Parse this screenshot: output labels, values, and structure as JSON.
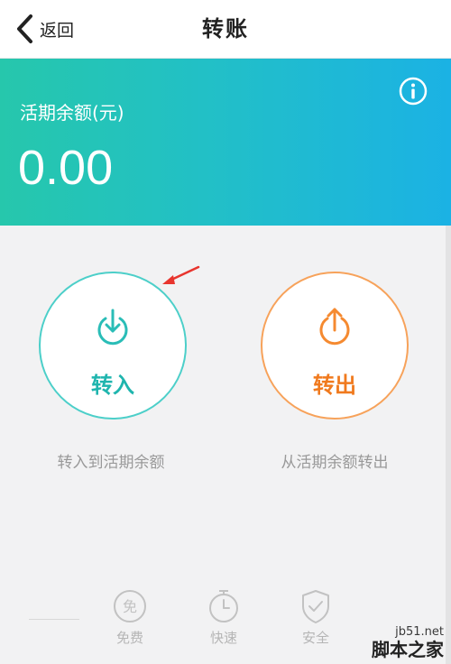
{
  "nav": {
    "back_label": "返回",
    "title": "转账"
  },
  "banner": {
    "balance_label": "活期余额(元)",
    "balance_value": "0.00",
    "gradient_colors": [
      "#26c7ac",
      "#1bb2e4"
    ]
  },
  "actions": [
    {
      "label": "转入",
      "description": "转入到活期余额",
      "color": "#1fb5ae",
      "icon": "download-circle-icon"
    },
    {
      "label": "转出",
      "description": "从活期余额转出",
      "color": "#f07a1e",
      "icon": "upload-circle-icon"
    }
  ],
  "features": [
    {
      "label": "免费",
      "icon": "free-icon"
    },
    {
      "label": "快速",
      "icon": "stopwatch-icon"
    },
    {
      "label": "安全",
      "icon": "shield-check-icon"
    }
  ],
  "watermark": {
    "site": "jb51.net",
    "text": "脚本之家"
  },
  "annotation": {
    "arrow_color": "#e8352e"
  }
}
